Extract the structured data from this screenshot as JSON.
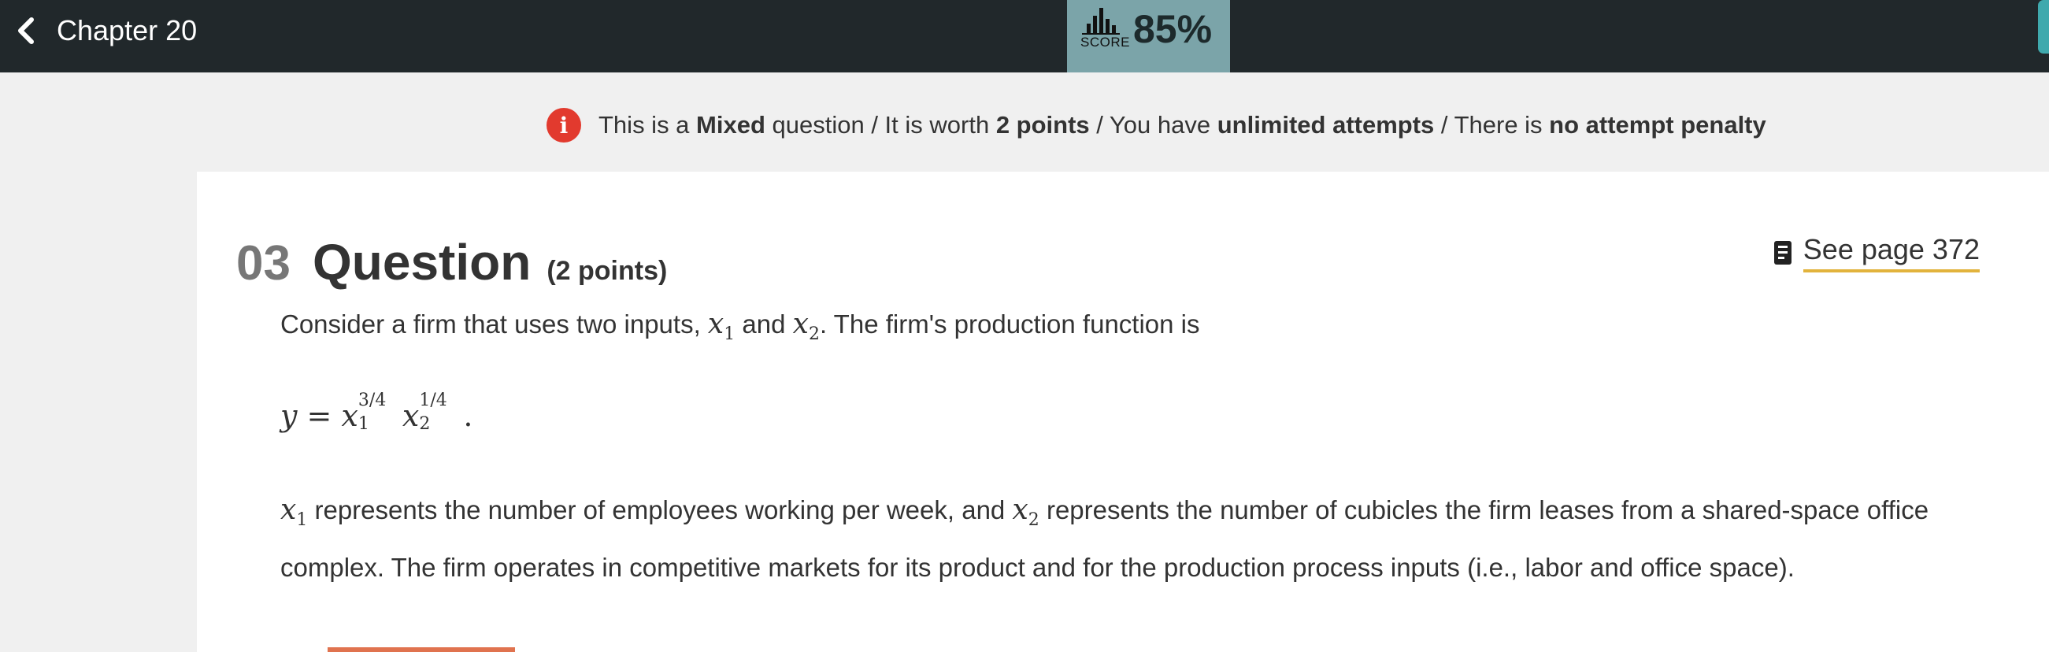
{
  "header": {
    "back_title": "Chapter 20",
    "score_label": "SCORE",
    "score_value": "85%"
  },
  "info": {
    "t1": "This is a ",
    "b1": "Mixed",
    "t2": " question / It is worth ",
    "b2": "2 points",
    "t3": " / You have ",
    "b3": "unlimited attempts",
    "t4": " / There is ",
    "b4": "no attempt penalty"
  },
  "question": {
    "number": "03",
    "word": "Question",
    "points": "(2 points)",
    "see_page": "See page 372",
    "p1_a": "Consider a firm that uses two inputs, ",
    "p1_b": " and ",
    "p1_c": ". The firm's production function is",
    "p3_a": " represents the number of employees working per week, and ",
    "p3_b": " represents the number of cubicles the firm leases from a shared-space office complex. The firm operates in competitive markets for its product and for the production process inputs (i.e., labor and office space).",
    "var_x": "x",
    "sub1": "1",
    "sub2": "2",
    "eq_y": "y",
    "eq_equals": " = ",
    "exp1": "3/4",
    "exp2": "1/4",
    "eq_end": "."
  },
  "colors": {
    "topbar": "#21282b",
    "score_bg": "#7ba4a9",
    "info_icon": "#e23a2e",
    "link_underline": "#e2b33c",
    "accent_tab": "#3fa9ad",
    "bottom_accent": "#e0734f"
  },
  "icons": [
    "chevron-left-icon",
    "bar-chart-icon",
    "info-icon",
    "ebook-icon"
  ]
}
